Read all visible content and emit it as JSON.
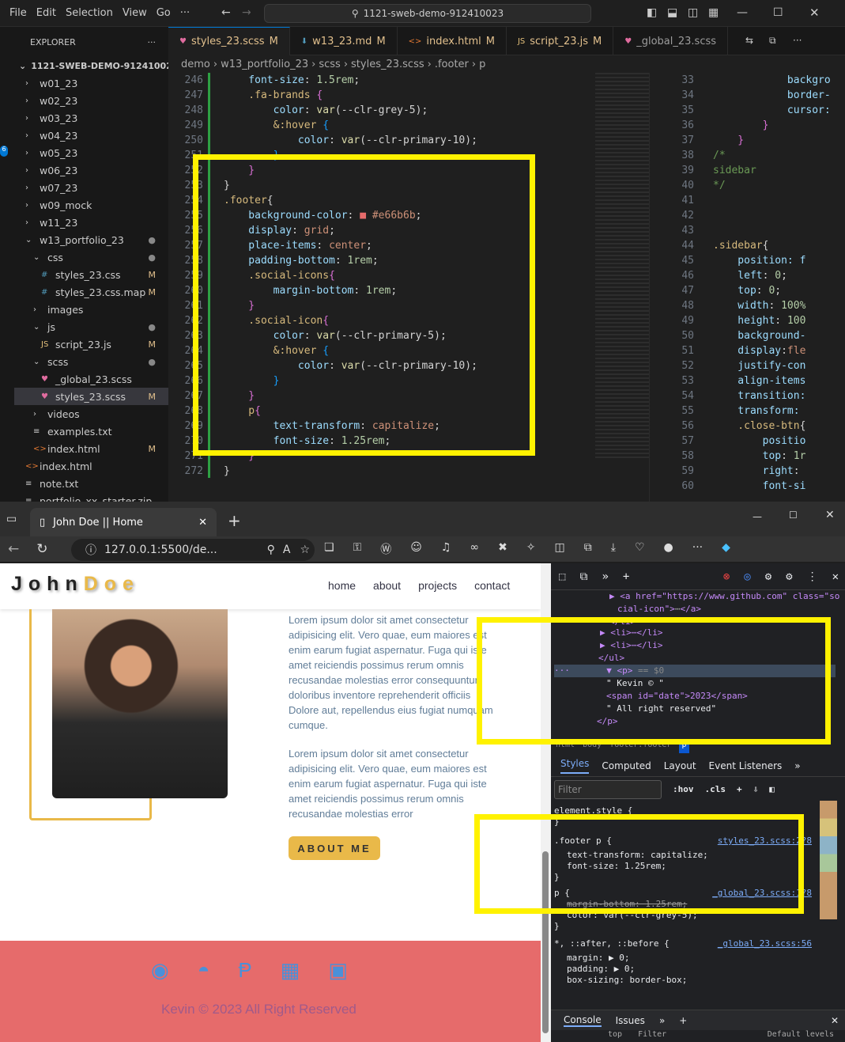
{
  "vscode": {
    "menu": [
      "File",
      "Edit",
      "Selection",
      "View",
      "Go",
      "···"
    ],
    "search": "1121-sweb-demo-912410023",
    "explorer_title": "EXPLORER",
    "root": "1121-SWEB-DEMO-912410023",
    "tree": [
      {
        "label": "w01_23",
        "indent": 1
      },
      {
        "label": "w02_23",
        "indent": 1
      },
      {
        "label": "w03_23",
        "indent": 1
      },
      {
        "label": "w04_23",
        "indent": 1
      },
      {
        "label": "w05_23",
        "indent": 1
      },
      {
        "label": "w06_23",
        "indent": 1
      },
      {
        "label": "w07_23",
        "indent": 1
      },
      {
        "label": "w09_mock",
        "indent": 1
      },
      {
        "label": "w11_23",
        "indent": 1
      },
      {
        "label": "w13_portfolio_23",
        "indent": 1,
        "badge": "●"
      },
      {
        "label": "css",
        "indent": 2,
        "badge": "●"
      },
      {
        "label": "styles_23.css",
        "indent": 3,
        "badge": "M"
      },
      {
        "label": "styles_23.css.map",
        "indent": 3,
        "badge": "M"
      },
      {
        "label": "images",
        "indent": 2
      },
      {
        "label": "js",
        "indent": 2,
        "badge": "●"
      },
      {
        "label": "script_23.js",
        "indent": 3,
        "badge": "M"
      },
      {
        "label": "scss",
        "indent": 2,
        "badge": "●"
      },
      {
        "label": "_global_23.scss",
        "indent": 3
      },
      {
        "label": "styles_23.scss",
        "indent": 3,
        "badge": "M"
      },
      {
        "label": "videos",
        "indent": 2
      },
      {
        "label": "examples.txt",
        "indent": 2
      },
      {
        "label": "index.html",
        "indent": 2,
        "badge": "M"
      },
      {
        "label": "index.html",
        "indent": 1
      },
      {
        "label": "note.txt",
        "indent": 1
      },
      {
        "label": "portfolio_xx_starter.zip",
        "indent": 1
      }
    ],
    "tabs": [
      {
        "label": "styles_23.scss",
        "badge": "M"
      },
      {
        "label": "w13_23.md",
        "badge": "M"
      },
      {
        "label": "index.html",
        "badge": "M"
      },
      {
        "label": "script_23.js",
        "badge": "M"
      },
      {
        "label": "_global_23.scss",
        "badge": ""
      }
    ],
    "breadcrumb": [
      "demo",
      "w13_portfolio_23",
      "scss",
      "styles_23.scss",
      ".footer",
      "p"
    ],
    "left_code_lines": [
      "246",
      "247",
      "248",
      "249",
      "250",
      "251",
      "252",
      "253",
      "254",
      "255",
      "256",
      "257",
      "258",
      "259",
      "260",
      "261",
      "262",
      "263",
      "264",
      "265",
      "266",
      "267",
      "268",
      "269",
      "270",
      "271",
      "272"
    ],
    "right_code_lines": [
      "33",
      "34",
      "35",
      "36",
      "37",
      "38",
      "39",
      "40",
      "41",
      "42",
      "43",
      "44",
      "45",
      "46",
      "47",
      "48",
      "49",
      "50",
      "51",
      "52",
      "53",
      "54",
      "55",
      "56",
      "57",
      "58",
      "59",
      "60"
    ]
  },
  "browser": {
    "tab_title": "John Doe || Home",
    "url": "127.0.0.1:5500/de...",
    "site": {
      "logo_first": "John",
      "logo_last": "Doe",
      "nav": [
        "home",
        "about",
        "projects",
        "contact"
      ],
      "para1": "Lorem ipsum dolor sit amet consectetur adipisicing elit. Vero quae, eum maiores est enim earum fugiat aspernatur. Fuga qui iste amet reiciendis possimus rerum omnis recusandae molestias error consequuntur doloribus inventore reprehenderit officiis Dolore aut, repellendus eius fugiat numquam cumque.",
      "para2": "Lorem ipsum dolor sit amet consectetur adipisicing elit. Vero quae, eum maiores est enim earum fugiat aspernatur. Fuga qui iste amet reiciendis possimus rerum omnis recusandae molestias error",
      "about_button": "ABOUT ME",
      "footer_text": "Kevin © 2023 All Right Reserved"
    }
  },
  "devtools": {
    "dom": {
      "link_line": "<a href=\"https://www.github.com\" class=\"so",
      "link_line2": "cial-icon\">",
      "li": "<li>",
      "ul_close": "</ul>",
      "p_open": "<p>",
      "eq": "== $0",
      "text1": "\" Kevin © \"",
      "span": "<span id=\"date\">2023</span>",
      "text2": "\" All right reserved\"",
      "p_close": "</p>"
    },
    "crumbs": [
      "html",
      "body",
      "footer.footer",
      "p"
    ],
    "panel_tabs": [
      "Styles",
      "Computed",
      "Layout",
      "Event Listeners"
    ],
    "filter_placeholder": "Filter",
    "hov": ":hov",
    "cls": ".cls",
    "element_style": "element.style {",
    "rule1_selector": ".footer p {",
    "rule1_source": "styles_23.scss:2?8",
    "rule1_props": [
      "text-transform: capitalize;",
      "font-size: 1.25rem;"
    ],
    "rule2_selector": "p {",
    "rule2_source": "_global_23.scss:1?8",
    "rule2_props": [
      "margin-bottom: 1.25rem;",
      "color: var(--clr-grey-5);"
    ],
    "rule3_selector": "*, ::after, ::before {",
    "rule3_source": "_global_23.scss:56",
    "rule3_props": [
      "margin: ▶ 0;",
      "padding: ▶ 0;",
      "box-sizing: border-box;"
    ],
    "bottom_tabs": [
      "Console",
      "Issues"
    ],
    "console_top": "top",
    "console_filter": "Filter",
    "default_levels": "Default levels"
  },
  "colors": {
    "footer_bg": "#e66b6b",
    "accent": "#e9b949",
    "highlight": "#fff200"
  }
}
